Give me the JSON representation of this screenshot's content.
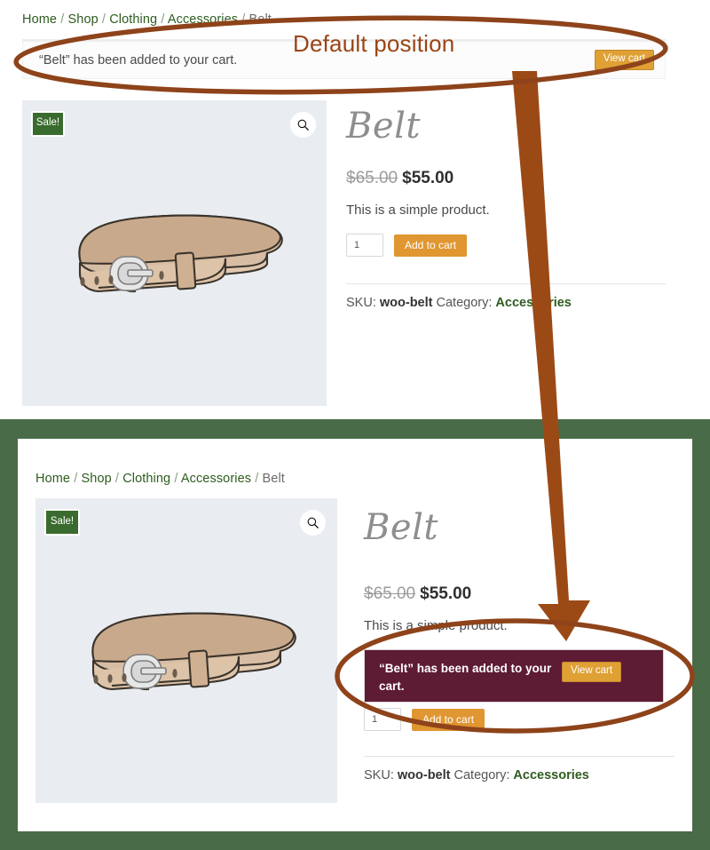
{
  "annotations": {
    "default_position_label": "Default position",
    "accent_color": "#9a4516",
    "arrow_color": "#9b4a16",
    "ellipse_color": "#8e431a"
  },
  "top_screen": {
    "breadcrumb": {
      "items": [
        "Home",
        "Shop",
        "Clothing",
        "Accessories",
        "Belt"
      ],
      "separator": "/"
    },
    "notice": {
      "message": "“Belt” has been added to your cart.",
      "button_label": "View cart",
      "background": "#fcfcfc",
      "text_color": "#4a4a4a"
    },
    "gallery": {
      "sale_badge": "Sale!",
      "zoom_icon": "magnifier-icon",
      "image_alt": "belt",
      "background": "#e9edf2"
    },
    "summary": {
      "title": "Belt",
      "price_old": "$65.00",
      "price_new": "$55.00",
      "short_description": "This is a simple product.",
      "quantity_value": "1",
      "add_to_cart_label": "Add to cart",
      "sku_label": "SKU:",
      "sku_value": "woo-belt",
      "category_label": "Category:",
      "category_value": "Accessories"
    }
  },
  "bottom_screen": {
    "frame_color": "#4a6b47",
    "breadcrumb": {
      "items": [
        "Home",
        "Shop",
        "Clothing",
        "Accessories",
        "Belt"
      ],
      "separator": "/"
    },
    "gallery": {
      "sale_badge": "Sale!",
      "zoom_icon": "magnifier-icon",
      "image_alt": "belt",
      "background": "#e9edf2"
    },
    "summary": {
      "title": "Belt",
      "price_old": "$65.00",
      "price_new": "$55.00",
      "short_description": "This is a simple product.",
      "quantity_value": "1",
      "add_to_cart_label": "Add to cart",
      "sku_label": "SKU:",
      "sku_value": "woo-belt",
      "category_label": "Category:",
      "category_value": "Accessories"
    },
    "notice": {
      "message": "“Belt” has been added to your cart.",
      "button_label": "View cart",
      "background": "#5d1b34",
      "text_color": "#ffffff"
    }
  }
}
